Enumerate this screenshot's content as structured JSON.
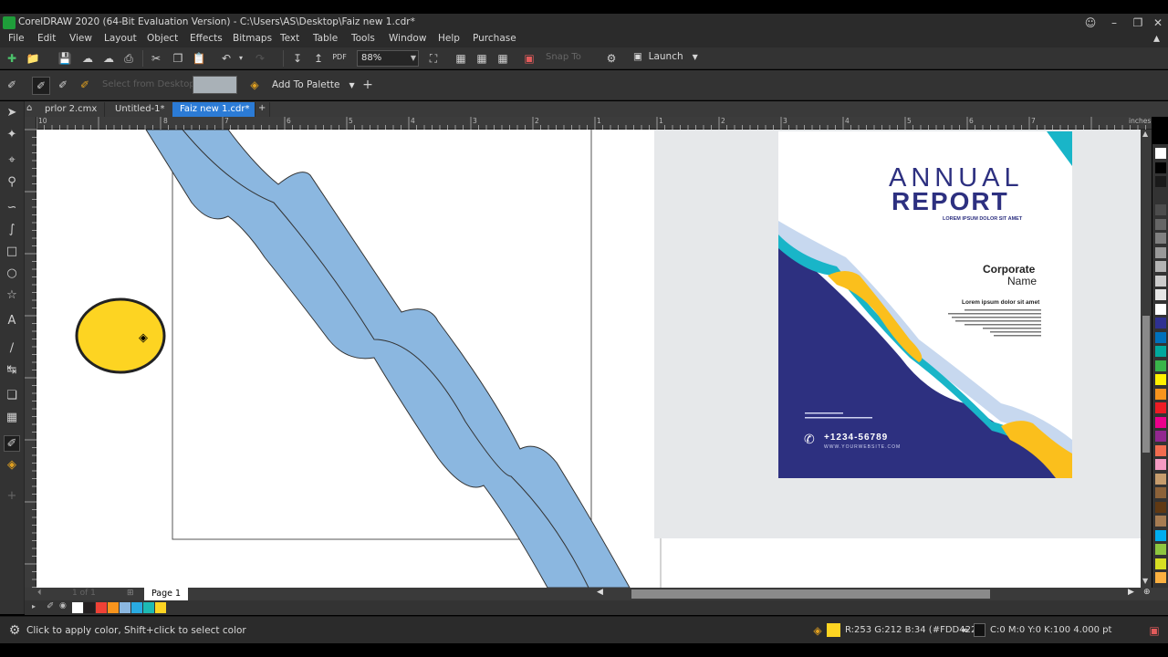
{
  "window": {
    "title": "CorelDRAW 2020 (64-Bit Evaluation Version) - C:\\Users\\AS\\Desktop\\Faiz new 1.cdr*"
  },
  "menu": [
    "File",
    "Edit",
    "View",
    "Layout",
    "Object",
    "Effects",
    "Bitmaps",
    "Text",
    "Table",
    "Tools",
    "Window",
    "Help",
    "Purchase"
  ],
  "toolbar": {
    "zoom": "88%",
    "snap_to": "Snap To",
    "launch": "Launch"
  },
  "propbar": {
    "select_from_desktop": "Select from Desktop",
    "add_to_palette": "Add To Palette"
  },
  "tabs": [
    "prlor 2.cmx",
    "Untitled-1*",
    "Faiz new 1.cdr*"
  ],
  "ruler": {
    "h_ticks": [
      "10",
      "8",
      "7",
      "6",
      "5",
      "4",
      "3",
      "2",
      "1",
      "1",
      "2",
      "3",
      "4",
      "5",
      "6",
      "7"
    ],
    "unit": "inches"
  },
  "report": {
    "annual": "ANNUAL",
    "report": "REPORT",
    "lorem_title": "LOREM IPSUM DOLOR SIT AMET",
    "corporate": "Corporate",
    "name": "Name",
    "lorem_heading": "Lorem ipsum dolor sit amet",
    "phone": "+1234-56789",
    "website": "WWW.YOURWEBSITE.COM"
  },
  "pagenav": {
    "page_tab": "Page 1",
    "page_count": "1 of 1"
  },
  "status": {
    "message": "Click to apply color, Shift+click to select color",
    "fill": "R:253 G:212 B:34 (#FDD422)",
    "fill_color": "#FDD422",
    "outline": "C:0 M:0 Y:0 K:100  4.000 pt"
  },
  "palette_colors": [
    "#ffffff",
    "#000000",
    "#1a1a1a",
    "#333333",
    "#4d4d4d",
    "#666666",
    "#808080",
    "#999999",
    "#b3b3b3",
    "#cccccc",
    "#e6e6e6",
    "#ffffff",
    "#2e3192",
    "#0071bc",
    "#00a99d",
    "#39b54a",
    "#fff200",
    "#f7941d",
    "#ed1c24",
    "#ec008c",
    "#92278f",
    "#f26c4f",
    "#f49ac2",
    "#c69c6d",
    "#8c6239",
    "#603913",
    "#a67c52",
    "#00aeef",
    "#8dc63f",
    "#d7df23",
    "#fbb040"
  ],
  "doc_palette": [
    "#ffffff",
    "#231f20",
    "#ef4136",
    "#f7941d",
    "#8bb7e0",
    "#29abe2",
    "#1dbab4",
    "#fdd422"
  ]
}
